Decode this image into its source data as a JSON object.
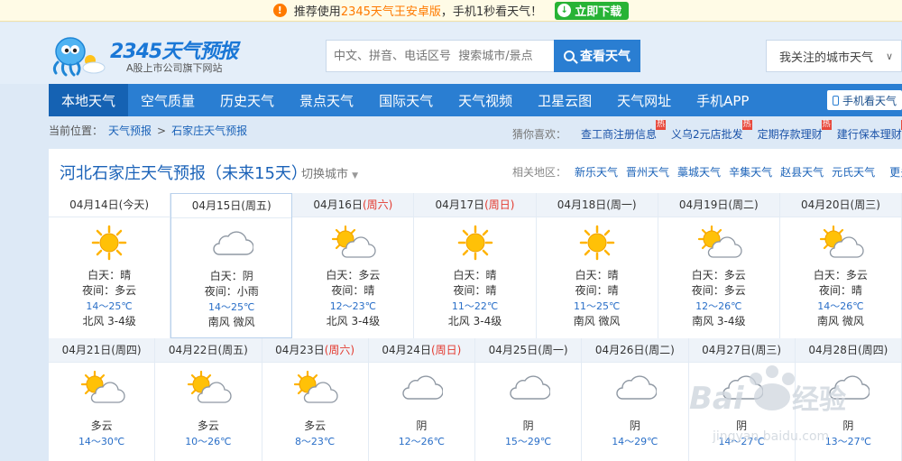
{
  "promo": {
    "prefix": "推荐使用",
    "highlight": "2345天气王安卓版",
    "suffix": "，手机1秒看天气！",
    "download": "立即下载"
  },
  "header": {
    "brand": "2345天气预报",
    "sub": "A股上市公司旗下网站",
    "search_placeholder": "中文、拼音、电话区号  搜索城市/景点",
    "search_button": "查看天气",
    "follow": "我关注的城市天气"
  },
  "nav": {
    "items": [
      "本地天气",
      "空气质量",
      "历史天气",
      "景点天气",
      "国际天气",
      "天气视频",
      "卫星云图",
      "天气网址",
      "手机APP"
    ],
    "phone": "手机看天气"
  },
  "breadcrumb": {
    "label": "当前位置：",
    "items": [
      "天气预报",
      "石家庄天气预报"
    ],
    "sep": ">"
  },
  "guess": {
    "label": "猜你喜欢：",
    "items": [
      "查工商注册信息",
      "义乌2元店批发",
      "定期存款理财",
      "建行保本理财"
    ],
    "hot": "热"
  },
  "panel": {
    "title": "河北石家庄天气预报（未来15天）",
    "switch": "切换城市",
    "related_label": "相关地区：",
    "related": [
      "新乐天气",
      "晋州天气",
      "藁城天气",
      "辛集天气",
      "赵县天气",
      "元氏天气"
    ],
    "more": "更多"
  },
  "colors": {
    "accent": "#2a7ed2",
    "nav_active": "#1562b3",
    "weekend_red": "#e33a2f",
    "temp_blue": "#2a6fc8"
  },
  "days_row1": [
    {
      "date": "04月14日",
      "wk": "(今天)",
      "red": false,
      "icon": "sun-icon",
      "day": "白天：晴",
      "night": "夜间：多云",
      "temp": "14～25℃",
      "wind": "北风  3-4级"
    },
    {
      "date": "04月15日",
      "wk": "(周五)",
      "red": false,
      "icon": "cloud-icon",
      "day": "白天：阴",
      "night": "夜间：小雨",
      "temp": "14～25℃",
      "wind": "南风  微风"
    },
    {
      "date": "04月16日",
      "wk": "(周六)",
      "red": true,
      "icon": "partly-cloudy-icon",
      "day": "白天：多云",
      "night": "夜间：晴",
      "temp": "12～23℃",
      "wind": "北风  3-4级"
    },
    {
      "date": "04月17日",
      "wk": "(周日)",
      "red": true,
      "icon": "sun-icon",
      "day": "白天：晴",
      "night": "夜间：晴",
      "temp": "11～22℃",
      "wind": "北风  3-4级"
    },
    {
      "date": "04月18日",
      "wk": "(周一)",
      "red": false,
      "icon": "sun-icon",
      "day": "白天：晴",
      "night": "夜间：晴",
      "temp": "11～25℃",
      "wind": "南风  微风"
    },
    {
      "date": "04月19日",
      "wk": "(周二)",
      "red": false,
      "icon": "partly-cloudy-icon",
      "day": "白天：多云",
      "night": "夜间：多云",
      "temp": "12～26℃",
      "wind": "南风  3-4级"
    },
    {
      "date": "04月20日",
      "wk": "(周三)",
      "red": false,
      "icon": "partly-cloudy-icon",
      "day": "白天：多云",
      "night": "夜间：晴",
      "temp": "14～26℃",
      "wind": "南风  微风"
    }
  ],
  "days_row2": [
    {
      "date": "04月21日",
      "wk": "(周四)",
      "red": false,
      "icon": "partly-cloudy-icon",
      "desc": "多云",
      "temp": "14～30℃"
    },
    {
      "date": "04月22日",
      "wk": "(周五)",
      "red": false,
      "icon": "partly-cloudy-icon",
      "desc": "多云",
      "temp": "10～26℃"
    },
    {
      "date": "04月23日",
      "wk": "(周六)",
      "red": true,
      "icon": "partly-cloudy-icon",
      "desc": "多云",
      "temp": "8～23℃"
    },
    {
      "date": "04月24日",
      "wk": "(周日)",
      "red": true,
      "icon": "cloud-icon",
      "desc": "阴",
      "temp": "12～26℃"
    },
    {
      "date": "04月25日",
      "wk": "(周一)",
      "red": false,
      "icon": "cloud-icon",
      "desc": "阴",
      "temp": "15～29℃"
    },
    {
      "date": "04月26日",
      "wk": "(周二)",
      "red": false,
      "icon": "cloud-icon",
      "desc": "阴",
      "temp": "14～29℃"
    },
    {
      "date": "04月27日",
      "wk": "(周三)",
      "red": false,
      "icon": "cloud-icon",
      "desc": "阴",
      "temp": "14～27℃"
    },
    {
      "date": "04月28日",
      "wk": "(周四)",
      "red": false,
      "icon": "cloud-icon",
      "desc": "阴",
      "temp": "13～27℃"
    }
  ],
  "watermark": {
    "text": "Baidu经验",
    "url": "jingyan.baidu.com"
  }
}
